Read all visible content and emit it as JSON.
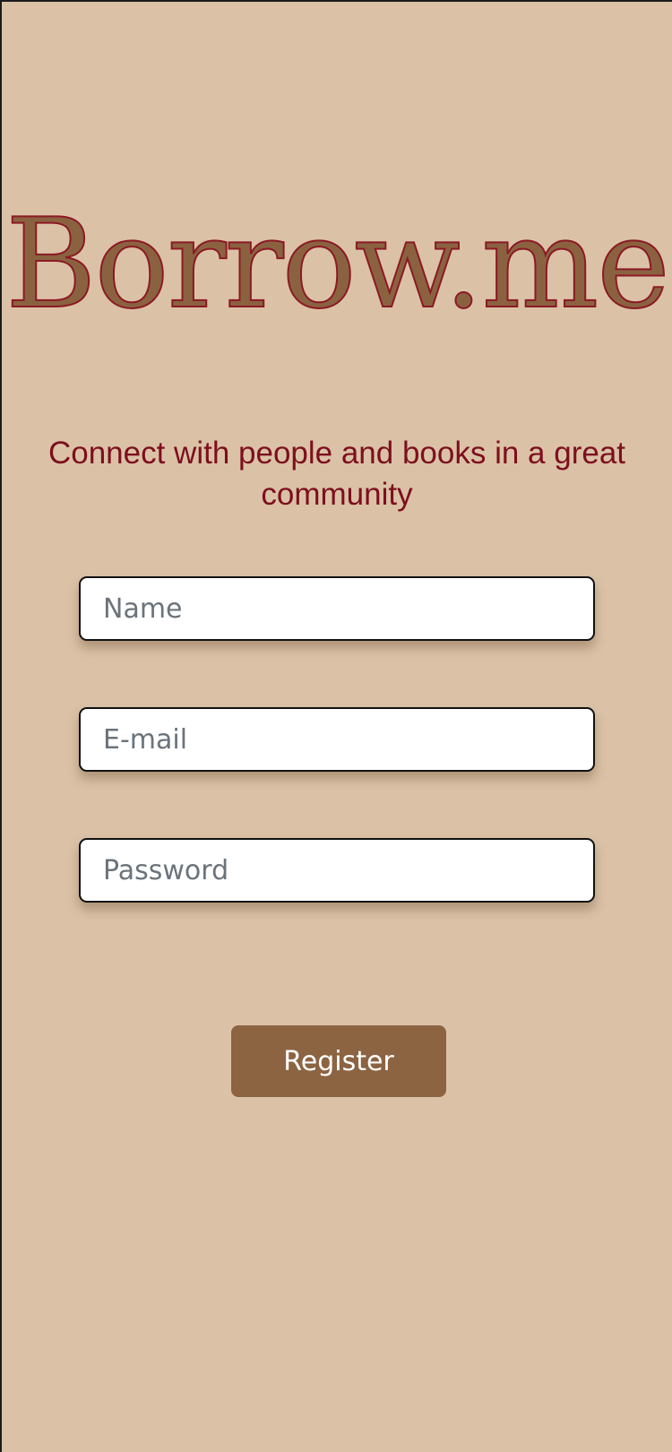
{
  "app": {
    "logo_text": "Borrow.me",
    "tagline": "Connect with people and books in a great community"
  },
  "form": {
    "name_placeholder": "Name",
    "name_value": "",
    "email_placeholder": "E-mail",
    "email_value": "",
    "password_placeholder": "Password",
    "password_value": "",
    "register_label": "Register"
  },
  "colors": {
    "background": "#dbc2a7",
    "brand_brown": "#8c6442",
    "accent_red": "#7d0f1e",
    "placeholder_gray": "#6b737b"
  }
}
